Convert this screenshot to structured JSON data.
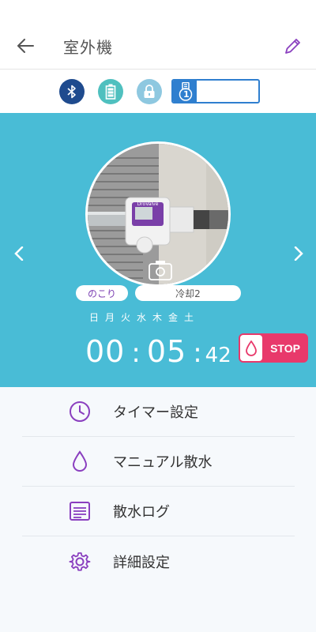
{
  "header": {
    "title": "室外機",
    "back_icon": "arrow-left-icon",
    "edit_icon": "pencil-icon"
  },
  "status": {
    "icons": [
      "bluetooth-icon",
      "battery-icon",
      "lock-icon",
      "sensor-icon"
    ],
    "sensor_number": "1",
    "sensor_level": 0.28,
    "colors": {
      "bluetooth": "#1f4b8e",
      "battery": "#4fc0bf",
      "lock": "#8ec8e0",
      "sensor": "#2f7fcf"
    }
  },
  "panel": {
    "background": "#49bcd6",
    "remain_label": "のこり",
    "mode_label": "冷却2",
    "days": [
      "日",
      "月",
      "火",
      "水",
      "木",
      "金",
      "土"
    ],
    "timer": {
      "hours": "00",
      "minutes": "05",
      "seconds": "42"
    },
    "stop_label": "STOP",
    "stop_color": "#e8396b",
    "device_brand": "DroValve"
  },
  "menu": {
    "items": [
      {
        "label": "タイマー設定",
        "icon": "clock-icon"
      },
      {
        "label": "マニュアル散水",
        "icon": "water-drop-icon"
      },
      {
        "label": "散水ログ",
        "icon": "log-list-icon"
      },
      {
        "label": "詳細設定",
        "icon": "gear-icon"
      }
    ],
    "accent": "#8a3fbf"
  }
}
